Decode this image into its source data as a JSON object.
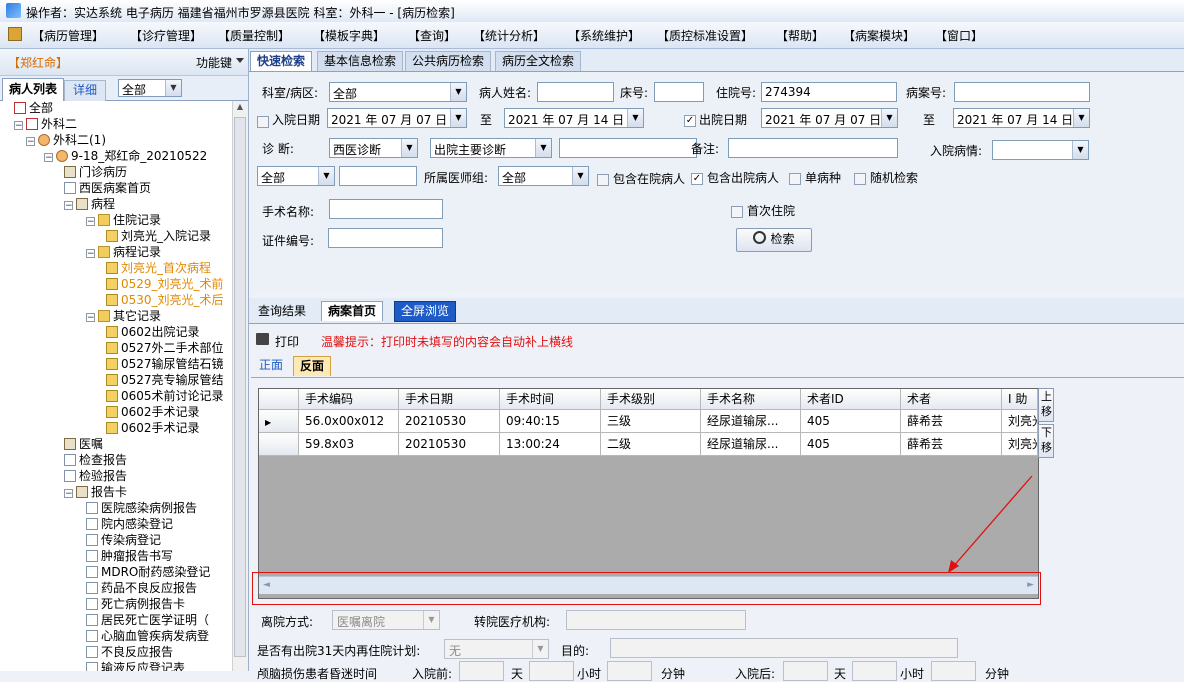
{
  "window": {
    "title": "操作者：实达系统 电子病历  福建省福州市罗源县医院  科室：外科一 - [病历检索]"
  },
  "menu": [
    "【病历管理】",
    "【诊疗管理】",
    "【质量控制】",
    "【模板字典】",
    "【查询】",
    "【统计分析】",
    "【系统维护】",
    "【质控标准设置】",
    "【帮助】",
    "【病案模块】",
    "【窗口】"
  ],
  "left_panel": {
    "patient_tag": "【郑红命】",
    "func_key": "功能键",
    "tab_list": "病人列表",
    "tab_detail": "详细",
    "filter": "全部",
    "tree": [
      {
        "text": "全部",
        "icon": "hosp-icon",
        "level": 0
      },
      {
        "text": "外科二",
        "icon": "hosp-icon",
        "level": 0
      },
      {
        "text": "外科二(1)",
        "icon": "pers-icon",
        "level": 1
      },
      {
        "text": "9-18_郑红命_20210522",
        "icon": "pers-icon",
        "level": 2
      },
      {
        "text": "门诊病历",
        "icon": "book-icon",
        "level": 3
      },
      {
        "text": "西医病案首页",
        "icon": "doc-icon",
        "level": 3
      },
      {
        "text": "病程",
        "icon": "book-icon",
        "level": 3
      },
      {
        "text": "住院记录",
        "icon": "folder-icon",
        "level": 4
      },
      {
        "text": "刘亮光_入院记录",
        "icon": "lock-icon",
        "level": 5
      },
      {
        "text": "病程记录",
        "icon": "folder-icon",
        "level": 4
      },
      {
        "text": "刘亮光_首次病程",
        "icon": "lock-icon",
        "level": 5,
        "color": "orange"
      },
      {
        "text": "0529_刘亮光_术前",
        "icon": "lock-icon",
        "level": 5,
        "color": "orange"
      },
      {
        "text": "0530_刘亮光_术后",
        "icon": "lock-icon",
        "level": 5,
        "color": "orange"
      },
      {
        "text": "其它记录",
        "icon": "folder-icon",
        "level": 4
      },
      {
        "text": "0602出院记录",
        "icon": "lock-icon",
        "level": 5
      },
      {
        "text": "0527外二手术部位",
        "icon": "lock-icon",
        "level": 5
      },
      {
        "text": "0527输尿管结石镜",
        "icon": "lock-icon",
        "level": 5
      },
      {
        "text": "0527亮专输尿管结",
        "icon": "lock-icon",
        "level": 5
      },
      {
        "text": "0605术前讨论记录",
        "icon": "lock-icon",
        "level": 5
      },
      {
        "text": "0602手术记录",
        "icon": "lock-icon",
        "level": 5
      },
      {
        "text": "0602手术记录",
        "icon": "lock-icon",
        "level": 5
      },
      {
        "text": "医嘱",
        "icon": "book-icon",
        "level": 3
      },
      {
        "text": "检查报告",
        "icon": "doc-icon",
        "level": 3
      },
      {
        "text": "检验报告",
        "icon": "doc-icon",
        "level": 3
      },
      {
        "text": "报告卡",
        "icon": "book-icon",
        "level": 3
      },
      {
        "text": "医院感染病例报告",
        "icon": "doc-icon",
        "level": 4
      },
      {
        "text": "院内感染登记",
        "icon": "doc-icon",
        "level": 4
      },
      {
        "text": "传染病登记",
        "icon": "doc-icon",
        "level": 4
      },
      {
        "text": "肿瘤报告书写",
        "icon": "doc-icon",
        "level": 4
      },
      {
        "text": "MDRO耐药感染登记",
        "icon": "doc-icon",
        "level": 4
      },
      {
        "text": "药品不良反应报告",
        "icon": "doc-icon",
        "level": 4
      },
      {
        "text": "死亡病例报告卡",
        "icon": "doc-icon",
        "level": 4
      },
      {
        "text": "居民死亡医学证明（",
        "icon": "doc-icon",
        "level": 4
      },
      {
        "text": "心脑血管疾病发病登",
        "icon": "doc-icon",
        "level": 4
      },
      {
        "text": "不良反应报告",
        "icon": "doc-icon",
        "level": 4
      },
      {
        "text": "输液反应登记表",
        "icon": "doc-icon",
        "level": 4
      }
    ]
  },
  "search_tabs": [
    "快速检索",
    "基本信息检索",
    "公共病历检索",
    "病历全文检索"
  ],
  "search": {
    "dept_label": "科室/病区:",
    "dept_value": "全部",
    "name_label": "病人姓名:",
    "bed_label": "床号:",
    "inpatient_label": "住院号:",
    "inpatient_value": "274394",
    "case_label": "病案号:",
    "admit_label": "入院日期",
    "admit_from": "2021 年 07 月 07 日",
    "to_label": "至",
    "admit_to": "2021 年 07 月 14 日",
    "discharge_label": "出院日期",
    "discharge_from": "2021 年 07 月 07 日",
    "discharge_to": "2021 年 07 月 14 日",
    "diag_label": "诊    断:",
    "diag_type": "西医诊断",
    "diag_kind": "出院主要诊断",
    "remark_label": "备注:",
    "admit_cond_label": "入院病情:",
    "filter_all": "全部",
    "doctor_group_label": "所属医师组:",
    "doctor_group_value": "全部",
    "include_in": "包含在院病人",
    "include_out": "包含出院病人",
    "single_disease": "单病种",
    "random_search": "随机检索",
    "surgery_label": "手术名称:",
    "first_admit": "首次住院",
    "cert_label": "证件编号:",
    "search_button": "检索"
  },
  "result_tabs": [
    "查询结果",
    "病案首页",
    "全屏浏览"
  ],
  "print": {
    "label": "打印",
    "tip": "温馨提示：打印时未填写的内容会自动补上横线"
  },
  "page_tabs": [
    "正面",
    "反面"
  ],
  "grid": {
    "columns": [
      "手术编码",
      "手术日期",
      "手术时间",
      "手术级别",
      "手术名称",
      "术者ID",
      "术者",
      "I 助"
    ],
    "rows": [
      [
        "56.0x00x012",
        "20210530",
        "09:40:15",
        "三级",
        "经尿道输尿...",
        "405",
        "薛希芸",
        "刘亮光"
      ],
      [
        "59.8x03",
        "20210530",
        "13:00:24",
        "二级",
        "经尿道输尿...",
        "405",
        "薛希芸",
        "刘亮光"
      ]
    ],
    "move_up": "上移",
    "move_down": "下移"
  },
  "bottom": {
    "leave_label": "离院方式:",
    "leave_value": "医嘱离院",
    "transfer_label": "转院医疗机构:",
    "readmit_label": "是否有出院31天内再住院计划:",
    "readmit_value": "无",
    "purpose_label": "目的:",
    "coma_label": "颅脑损伤患者昏迷时间",
    "before_label": "入院前:",
    "after_label": "入院后:",
    "day": "天",
    "hour": "小时",
    "minute": "分钟"
  },
  "colors": {
    "accent_red": "#e01010",
    "tab_active_blue": "#1e5bc6",
    "orange_text": "#e28a00"
  }
}
